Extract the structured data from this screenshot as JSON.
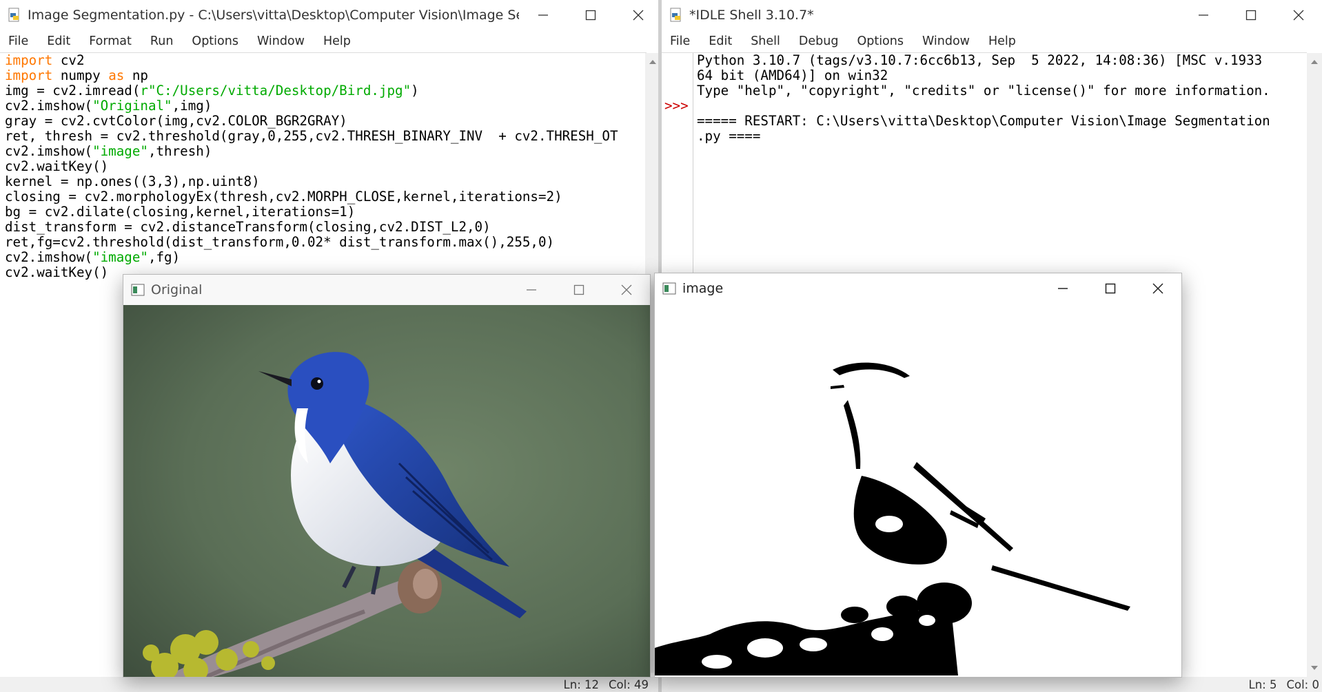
{
  "editor": {
    "title": "Image Segmentation.py - C:\\Users\\vitta\\Desktop\\Computer Vision\\Image Segmentatio...",
    "menu": [
      "File",
      "Edit",
      "Format",
      "Run",
      "Options",
      "Window",
      "Help"
    ],
    "code_lines": [
      [
        [
          "kw",
          "import"
        ],
        [
          "t",
          " cv2"
        ]
      ],
      [
        [
          "kw",
          "import"
        ],
        [
          "t",
          " numpy "
        ],
        [
          "kw",
          "as"
        ],
        [
          "t",
          " np"
        ]
      ],
      [
        [
          "t",
          "img = cv2.imread("
        ],
        [
          "str",
          "r\"C:/Users/vitta/Desktop/Bird.jpg\""
        ],
        [
          "t",
          ")"
        ]
      ],
      [
        [
          "t",
          "cv2.imshow("
        ],
        [
          "str",
          "\"Original\""
        ],
        [
          "t",
          ",img)"
        ]
      ],
      [
        [
          "t",
          "gray = cv2.cvtColor(img,cv2.COLOR_BGR2GRAY)"
        ]
      ],
      [
        [
          "t",
          "ret, thresh = cv2.threshold(gray,0,255,cv2.THRESH_BINARY_INV  + cv2.THRESH_OT"
        ]
      ],
      [
        [
          "t",
          "cv2.imshow("
        ],
        [
          "str",
          "\"image\""
        ],
        [
          "t",
          ",thresh)"
        ]
      ],
      [
        [
          "t",
          "cv2.waitKey()"
        ]
      ],
      [
        [
          "t",
          "kernel = np.ones((3,3),np.uint8)"
        ]
      ],
      [
        [
          "t",
          "closing = cv2.morphologyEx(thresh,cv2.MORPH_CLOSE,kernel,iterations=2)"
        ]
      ],
      [
        [
          "t",
          "bg = cv2.dilate(closing,kernel,iterations=1)"
        ]
      ],
      [
        [
          "t",
          "dist_transform = cv2.distanceTransform(closing,cv2.DIST_L2,0)"
        ]
      ],
      [
        [
          "t",
          "ret,fg=cv2.threshold(dist_transform,0.02* dist_transform.max(),255,0)"
        ]
      ],
      [
        [
          "t",
          "cv2.imshow("
        ],
        [
          "str",
          "\"image\""
        ],
        [
          "t",
          ",fg)"
        ]
      ],
      [
        [
          "t",
          "cv2.waitKey()"
        ]
      ]
    ],
    "status_ln": "Ln: 12",
    "status_col": "Col: 49"
  },
  "shell": {
    "title": "*IDLE Shell 3.10.7*",
    "menu": [
      "File",
      "Edit",
      "Shell",
      "Debug",
      "Options",
      "Window",
      "Help"
    ],
    "prompt": ">>>",
    "lines": [
      "Python 3.10.7 (tags/v3.10.7:6cc6b13, Sep  5 2022, 14:08:36) [MSC v.1933",
      "64 bit (AMD64)] on win32",
      "Type \"help\", \"copyright\", \"credits\" or \"license()\" for more information.",
      "",
      "===== RESTART: C:\\Users\\vitta\\Desktop\\Computer Vision\\Image Segmentation",
      ".py ===="
    ],
    "status_ln": "Ln: 5",
    "status_col": "Col: 0"
  },
  "original_window": {
    "title": "Original"
  },
  "image_window": {
    "title": "image"
  },
  "colors": {
    "keyword": "#ff7700",
    "string": "#00aa00",
    "prompt": "#cc0000",
    "bird_blue": "#2a4fc0"
  }
}
